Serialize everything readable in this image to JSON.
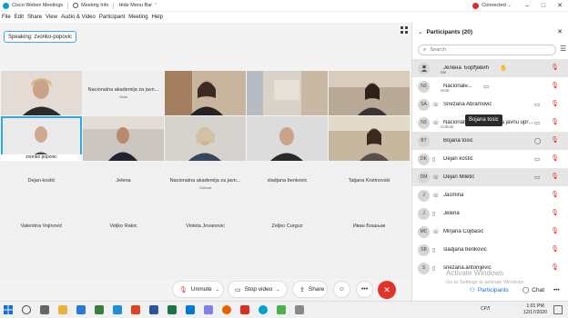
{
  "titlebar": {
    "app_title": "Cisco Webex Meetings",
    "meeting_info": "Meeting Info",
    "hide_menu_bar": "Hide Menu Bar",
    "connection_status": "Connected",
    "brand_color": "#00a0d1",
    "status_color": "#d32f2f"
  },
  "menu": [
    "File",
    "Edit",
    "Share",
    "View",
    "Audio & Video",
    "Participant",
    "Meeting",
    "Help"
  ],
  "speaking": "Speaking: zvonko-popovic",
  "video_tiles": [
    {
      "caption": "",
      "center": "",
      "sub": "",
      "kind": "video"
    },
    {
      "caption": "",
      "center": "Nacionalna akademija za javn...",
      "sub": "Host",
      "kind": "name"
    },
    {
      "caption": "",
      "center": "",
      "sub": "",
      "kind": "video"
    },
    {
      "caption": "",
      "center": "",
      "sub": "",
      "kind": "video"
    },
    {
      "caption": "",
      "center": "",
      "sub": "",
      "kind": "video"
    },
    {
      "caption": "zvonko popovic",
      "center": "",
      "sub": "",
      "kind": "video-active"
    },
    {
      "caption": "",
      "center": "",
      "sub": "",
      "kind": "video"
    },
    {
      "caption": "",
      "center": "",
      "sub": "",
      "kind": "video"
    },
    {
      "caption": "",
      "center": "",
      "sub": "",
      "kind": "video"
    },
    {
      "caption": "",
      "center": "",
      "sub": "",
      "kind": "video"
    }
  ],
  "name_tiles": [
    {
      "name": "Dejan kostić",
      "sub": ""
    },
    {
      "name": "Jelena",
      "sub": ""
    },
    {
      "name": "Nacionalna akademija za javn...",
      "sub": "Cohost"
    },
    {
      "name": "sladjana benkovic",
      "sub": ""
    },
    {
      "name": "Tatjana Krstinovski",
      "sub": ""
    },
    {
      "name": "Valentina Vojinović",
      "sub": ""
    },
    {
      "name": "Veljko Rakic",
      "sub": ""
    },
    {
      "name": "Violeta Jovanovic",
      "sub": ""
    },
    {
      "name": "Zeljko Curguz",
      "sub": ""
    },
    {
      "name": "Иван Бошњак",
      "sub": ""
    }
  ],
  "controls": {
    "unmute": "Unmute",
    "stop_video": "Stop video",
    "share": "Share",
    "end_color": "#e0342b"
  },
  "participants": {
    "header": "Participants (20)",
    "search_placeholder": "Search",
    "tooltip": "Bojana tosic",
    "items": [
      {
        "initials": "",
        "name": "Jeлена Ђорђевић",
        "role": "Me",
        "device": "",
        "mid": "hand"
      },
      {
        "initials": "N3",
        "name": "Nacionalн...",
        "role": "Host",
        "device": "",
        "mid": "cc"
      },
      {
        "initials": "SA",
        "name": "Snežana Abramović",
        "role": "",
        "device": "phone",
        "mid": "cam"
      },
      {
        "initials": "N3",
        "name": "Nacionalna akademija za javnu upra...",
        "role": "Cohost",
        "device": "phone",
        "mid": "cam"
      },
      {
        "initials": "BT",
        "name": "Bojana tosic",
        "role": "",
        "device": "",
        "mid": "chat"
      },
      {
        "initials": "DK",
        "name": "Dejan kostić",
        "role": "",
        "device": "",
        "mid": "cam"
      },
      {
        "initials": "DM",
        "name": "Dejan Miletić",
        "role": "",
        "device": "",
        "mid": "cam"
      },
      {
        "initials": "J",
        "name": "Jasmina",
        "role": "",
        "device": "phone",
        "mid": ""
      },
      {
        "initials": "J",
        "name": "Jelena",
        "role": "",
        "device": "",
        "mid": ""
      },
      {
        "initials": "MC",
        "name": "Mirjana Cojbasic",
        "role": "",
        "device": "phone",
        "mid": ""
      },
      {
        "initials": "SB",
        "name": "sladjana benkovic",
        "role": "",
        "device": "",
        "mid": ""
      },
      {
        "initials": "S",
        "name": "snezana.antonijevic",
        "role": "",
        "device": "",
        "mid": ""
      }
    ]
  },
  "tabs": {
    "participants": "Participants",
    "chat": "Chat"
  },
  "watermark": {
    "line1": "Activate Windows",
    "line2": "Go to Settings to activate Windows."
  },
  "taskbar": {
    "lang": "CPЛ",
    "time": "1:01 PM",
    "date": "12/17/2020"
  }
}
